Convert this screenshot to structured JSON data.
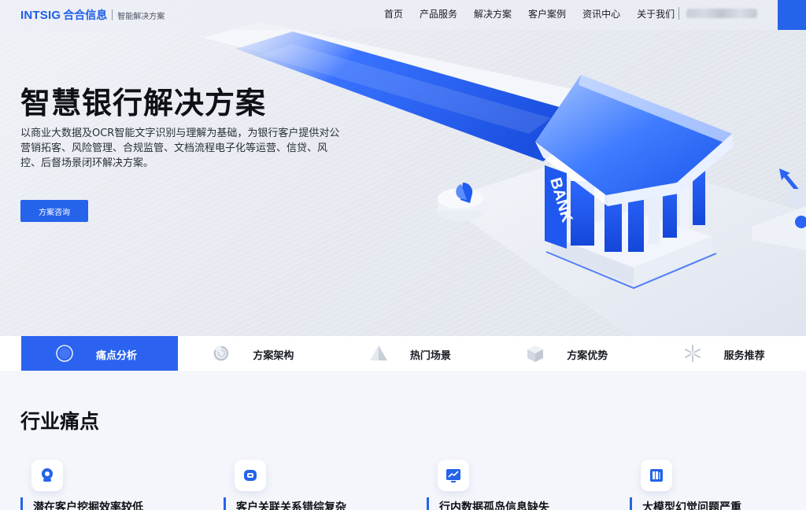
{
  "brand": {
    "logo_en": "INTSIG",
    "logo_cn": "合合信息",
    "tagline": "智能解决方案"
  },
  "nav": {
    "items": [
      "首页",
      "产品服务",
      "解决方案",
      "客户案例",
      "资讯中心",
      "关于我们"
    ]
  },
  "hero": {
    "title": "智慧银行解决方案",
    "description": "以商业大数据及OCR智能文字识别与理解为基础，为银行客户提供对公营销拓客、风险管理、合规监管、文档流程电子化等运营、信贷、风控、后督场景闭环解决方案。",
    "button_label": "方案咨询",
    "bank_sign": "BANK"
  },
  "tabs": [
    {
      "label": "痛点分析",
      "icon": "circle-icon",
      "active": true
    },
    {
      "label": "方案架构",
      "icon": "swirl-icon",
      "active": false
    },
    {
      "label": "热门场景",
      "icon": "pyramid-icon",
      "active": false
    },
    {
      "label": "方案优势",
      "icon": "cube-icon",
      "active": false
    },
    {
      "label": "服务推荐",
      "icon": "snowflake-icon",
      "active": false
    }
  ],
  "section": {
    "title": "行业痛点"
  },
  "cards": [
    {
      "title": "潜在客户挖掘效率较低",
      "icon": "target-user-icon"
    },
    {
      "title": "客户关联关系错综复杂",
      "icon": "network-icon"
    },
    {
      "title": "行内数据孤岛信息缺失",
      "icon": "chart-screen-icon"
    },
    {
      "title": "大模型幻觉问题严重",
      "icon": "books-icon"
    }
  ],
  "colors": {
    "accent": "#2563eb",
    "tab_active": "#2b63f0",
    "text": "#0f1116"
  }
}
